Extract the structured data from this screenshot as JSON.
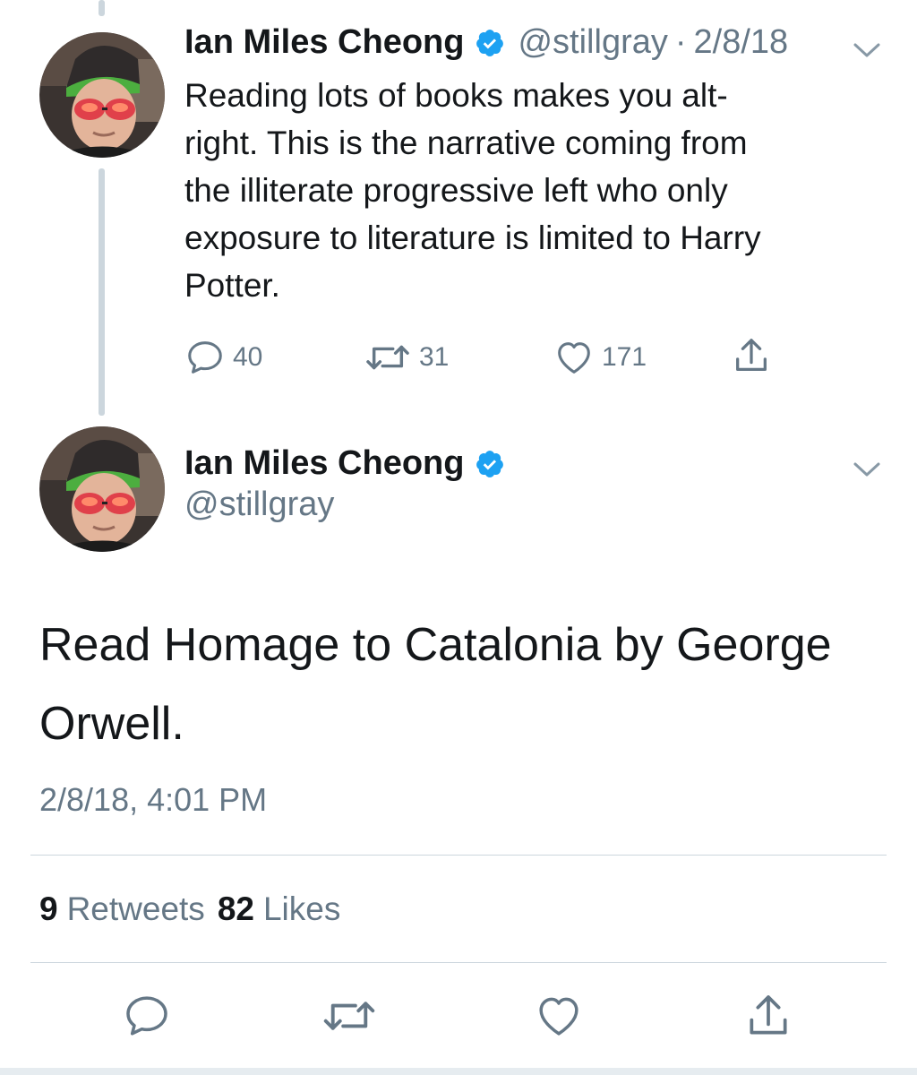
{
  "tweet1": {
    "author_name": "Ian Miles Cheong",
    "handle": "@stillgray",
    "separator": "·",
    "date": "2/8/18",
    "text": "Reading lots of books makes you alt-\nright. This is the narrative coming from\nthe illiterate progressive left who only\nexposure to literature is limited to Harry\nPotter.",
    "replies": "40",
    "retweets": "31",
    "likes": "171"
  },
  "tweet2": {
    "author_name": "Ian Miles Cheong",
    "handle": "@stillgray",
    "text": "Read Homage to Catalonia by George\nOrwell.",
    "timestamp": "2/8/18, 4:01 PM",
    "retweet_count": "9",
    "retweet_label": "Retweets",
    "like_count": "82",
    "like_label": "Likes"
  },
  "icons": {
    "verified": "verified-badge-icon",
    "chevron": "chevron-down-icon",
    "reply": "reply-icon",
    "retweet": "retweet-icon",
    "like": "heart-icon",
    "share": "share-icon"
  },
  "colors": {
    "verified_blue": "#1da1f2",
    "secondary_text": "#657786",
    "primary_text": "#14171a",
    "divider": "#ccd6dd"
  }
}
